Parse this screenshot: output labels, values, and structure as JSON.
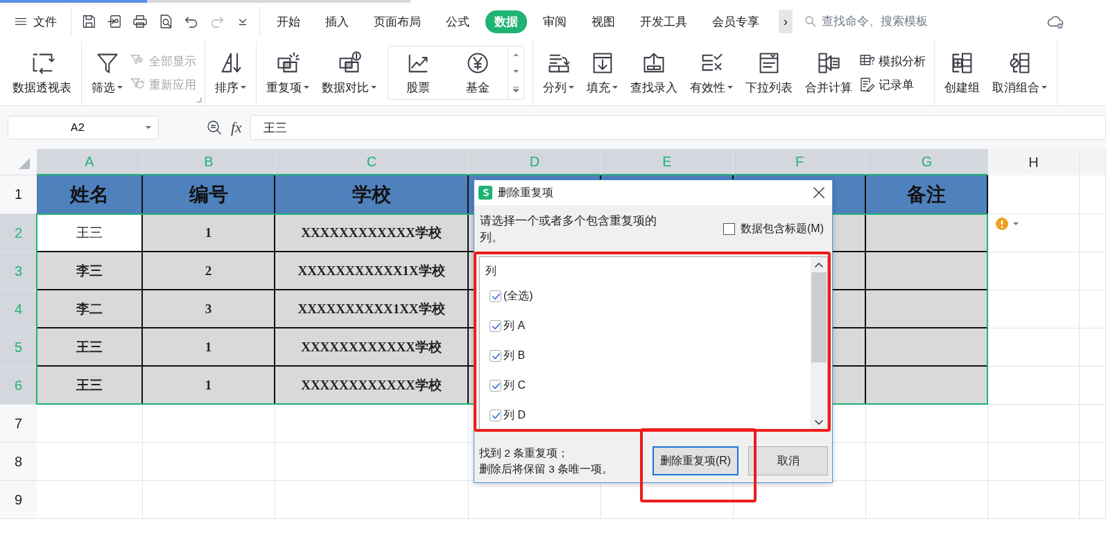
{
  "app_menu": {
    "label": "文件"
  },
  "quick_access": {
    "redo": {
      "disabled": true
    }
  },
  "tabs": [
    {
      "label": "开始",
      "selected": false
    },
    {
      "label": "插入",
      "selected": false
    },
    {
      "label": "页面布局",
      "selected": false
    },
    {
      "label": "公式",
      "selected": false
    },
    {
      "label": "数据",
      "selected": true
    },
    {
      "label": "审阅",
      "selected": false
    },
    {
      "label": "视图",
      "selected": false
    },
    {
      "label": "开发工具",
      "selected": false
    },
    {
      "label": "会员专享",
      "selected": false
    }
  ],
  "more_tabs": "›",
  "search": {
    "placeholder": "查找命令、搜索模板"
  },
  "ribbon": [
    {
      "launcher": false,
      "items": [
        {
          "kind": "large",
          "label": "数据透视表",
          "dropdown": false
        }
      ]
    },
    {
      "launcher": true,
      "items": [
        {
          "kind": "large",
          "label": "筛选",
          "dropdown": true
        },
        {
          "kind": "stack",
          "items": [
            {
              "label": "全部显示",
              "disabled": true
            },
            {
              "label": "重新应用",
              "disabled": true
            }
          ]
        }
      ]
    },
    {
      "launcher": false,
      "items": [
        {
          "kind": "large",
          "label": "排序",
          "dropdown": true
        }
      ]
    },
    {
      "launcher": false,
      "items": [
        {
          "kind": "large",
          "label": "重复项",
          "dropdown": true
        },
        {
          "kind": "large",
          "label": "数据对比",
          "dropdown": true
        },
        {
          "kind": "gallery",
          "items": [
            {
              "label": "股票"
            },
            {
              "label": "基金"
            }
          ]
        }
      ]
    },
    {
      "launcher": false,
      "items": [
        {
          "kind": "large",
          "label": "分列",
          "dropdown": true
        },
        {
          "kind": "large",
          "label": "填充",
          "dropdown": true
        },
        {
          "kind": "large",
          "label": "查找录入",
          "dropdown": false
        },
        {
          "kind": "large",
          "label": "有效性",
          "dropdown": true
        },
        {
          "kind": "large",
          "label": "下拉列表",
          "dropdown": false
        },
        {
          "kind": "large",
          "label": "合并计算",
          "dropdown": false
        },
        {
          "kind": "stack",
          "items": [
            {
              "label": "模拟分析",
              "disabled": false
            },
            {
              "label": "记录单",
              "disabled": false
            }
          ]
        }
      ]
    },
    {
      "launcher": false,
      "items": [
        {
          "kind": "large",
          "label": "创建组",
          "dropdown": false
        },
        {
          "kind": "large",
          "label": "取消组合",
          "dropdown": true
        }
      ]
    }
  ],
  "name_box": {
    "value": "A2"
  },
  "formula_bar": {
    "label": "fx",
    "value": "王三"
  },
  "sheet": {
    "columns": [
      {
        "label": "A",
        "selected": true
      },
      {
        "label": "B",
        "selected": true
      },
      {
        "label": "C",
        "selected": true
      },
      {
        "label": "D",
        "selected": true
      },
      {
        "label": "E",
        "selected": true
      },
      {
        "label": "F",
        "selected": true
      },
      {
        "label": "G",
        "selected": true
      },
      {
        "label": "H",
        "selected": false
      }
    ],
    "header_row": {
      "number": "1",
      "selected": false,
      "cells": [
        "姓名",
        "编号",
        "学校"
      ],
      "last_cell": "备注"
    },
    "rows": [
      {
        "number": "2",
        "selected": true,
        "active": true,
        "cells": [
          "王三",
          "1",
          "XXXXXXXXXXXX学校"
        ]
      },
      {
        "number": "3",
        "selected": true,
        "active": false,
        "cells": [
          "李三",
          "2",
          "XXXXXXXXXXX1X学校"
        ]
      },
      {
        "number": "4",
        "selected": true,
        "active": false,
        "cells": [
          "李二",
          "3",
          "XXXXXXXXXX1XX学校"
        ]
      },
      {
        "number": "5",
        "selected": true,
        "active": false,
        "cells": [
          "王三",
          "1",
          "XXXXXXXXXXXX学校"
        ]
      },
      {
        "number": "6",
        "selected": true,
        "active": false,
        "cells": [
          "王三",
          "1",
          "XXXXXXXXXXXX学校"
        ]
      }
    ],
    "empty_rows": [
      {
        "number": "7",
        "selected": false
      },
      {
        "number": "8",
        "selected": false
      },
      {
        "number": "9",
        "selected": false
      }
    ],
    "warning_marker": true
  },
  "dialog": {
    "title": "删除重复项",
    "prompt": "请选择一个或者多个包含重复项的列。",
    "header_option": {
      "label": "数据包含标题(M)",
      "checked": false
    },
    "list_header": "列",
    "highlight_list": true,
    "columns": [
      {
        "label": "(全选)",
        "checked": true
      },
      {
        "label": "列 A",
        "checked": true
      },
      {
        "label": "列 B",
        "checked": true
      },
      {
        "label": "列 C",
        "checked": true
      },
      {
        "label": "列 D",
        "checked": true
      }
    ],
    "status": [
      "找到 2 条重复项；",
      "删除后将保留 3 条唯一项。"
    ],
    "buttons": [
      {
        "label": "删除重复项(R)",
        "kind": "default",
        "highlighted": true
      },
      {
        "label": "取消",
        "kind": "normal",
        "highlighted": false
      }
    ]
  }
}
